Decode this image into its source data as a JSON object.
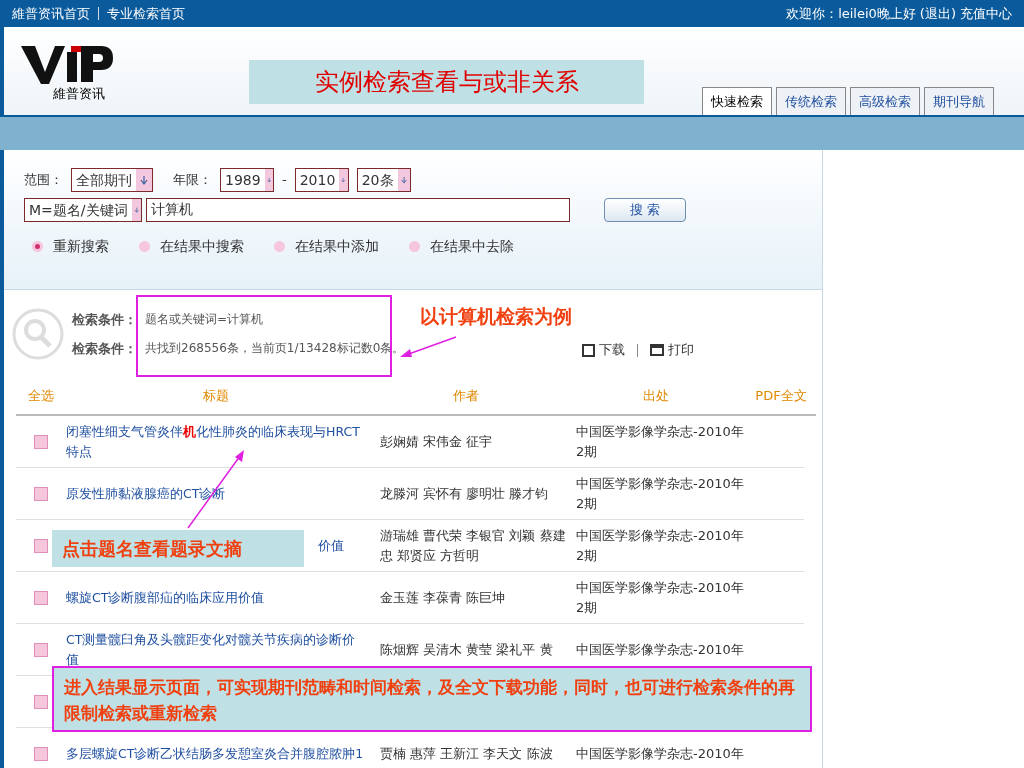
{
  "top_bar": {
    "links": [
      "維普资讯首页",
      "专业检索首页"
    ],
    "welcome": "欢迎你：leilei0晚上好",
    "logout": "(退出)",
    "recharge": "充值中心"
  },
  "logo": {
    "text": "維普资讯"
  },
  "slide_title": "实例检索查看与或非关系",
  "tabs": [
    {
      "label": "快速检索",
      "selected": true
    },
    {
      "label": "传统检索",
      "selected": false
    },
    {
      "label": "高级检索",
      "selected": false
    },
    {
      "label": "期刊导航",
      "selected": false
    }
  ],
  "search": {
    "scope_label": "范围：",
    "scope": "全部期刊",
    "years_label": "年限：",
    "year_from": "1989",
    "dash": "-",
    "year_to": "2010",
    "per_page": "20条",
    "field": "M=题名/关键词",
    "query": "计算机",
    "button": "搜 索",
    "modes": [
      {
        "label": "重新搜索",
        "selected": true
      },
      {
        "label": "在结果中搜索",
        "selected": false
      },
      {
        "label": "在结果中添加",
        "selected": false
      },
      {
        "label": "在结果中去除",
        "selected": false
      }
    ]
  },
  "conditions": [
    {
      "label": "检索条件：",
      "value": "题名或关键词=计算机"
    },
    {
      "label": "检索条件：",
      "value": "共找到268556条，当前页1/13428标记数0条。"
    }
  ],
  "actions": [
    "下载",
    "打印"
  ],
  "table": {
    "columns": [
      "全选",
      "标题",
      "作者",
      "出处",
      "PDF全文"
    ],
    "rows": [
      {
        "checked": false,
        "title": "闭塞性细支气管炎伴**机**化性肺炎的临床表现与HRCT特点",
        "authors": "彭娴婧 宋伟金 征宇",
        "source": "中国医学影像学杂志-2010年2期"
      },
      {
        "checked": false,
        "title": "原发性肺黏液腺癌的CT诊断",
        "authors": "龙滕河 宾怀有 廖明壮 滕才钧",
        "source": "中国医学影像学杂志-2010年2期"
      },
      {
        "checked": false,
        "title": "价值",
        "authors": "游瑞雄 曹代荣 李银官 刘颖 蔡建忠 郑贤应 方哲明",
        "source": "中国医学影像学杂志-2010年2期"
      },
      {
        "checked": false,
        "title": "螺旋CT诊断腹部疝的临床应用价值",
        "authors": "金玉莲 李葆青 陈巨坤",
        "source": "中国医学影像学杂志-2010年2期"
      },
      {
        "checked": false,
        "title": "CT测量髋臼角及头髋距变化对髋关节疾病的诊断价值",
        "authors": "陈烟辉 吴清木 黄莹 梁礼平 黄",
        "source": "中国医学影像学杂志-2010年"
      },
      {
        "checked": false
      },
      {
        "checked": false,
        "title": "多层螺旋CT诊断乙状结肠多发憩室炎合并腹腔脓肿1",
        "authors": "贾楠 惠萍 王新江 李天文 陈波",
        "source": "中国医学影像学杂志-2010年"
      }
    ]
  },
  "notes": [
    {
      "text": "以计算机检索为例"
    },
    {
      "text": "点击题名查看题录文摘"
    },
    {
      "text": "进入结果显示页面，可实现期刊范畴和时间检索，及全文下载功能，同时，也可进行检索条件的再限制检索或重新检索"
    }
  ]
}
